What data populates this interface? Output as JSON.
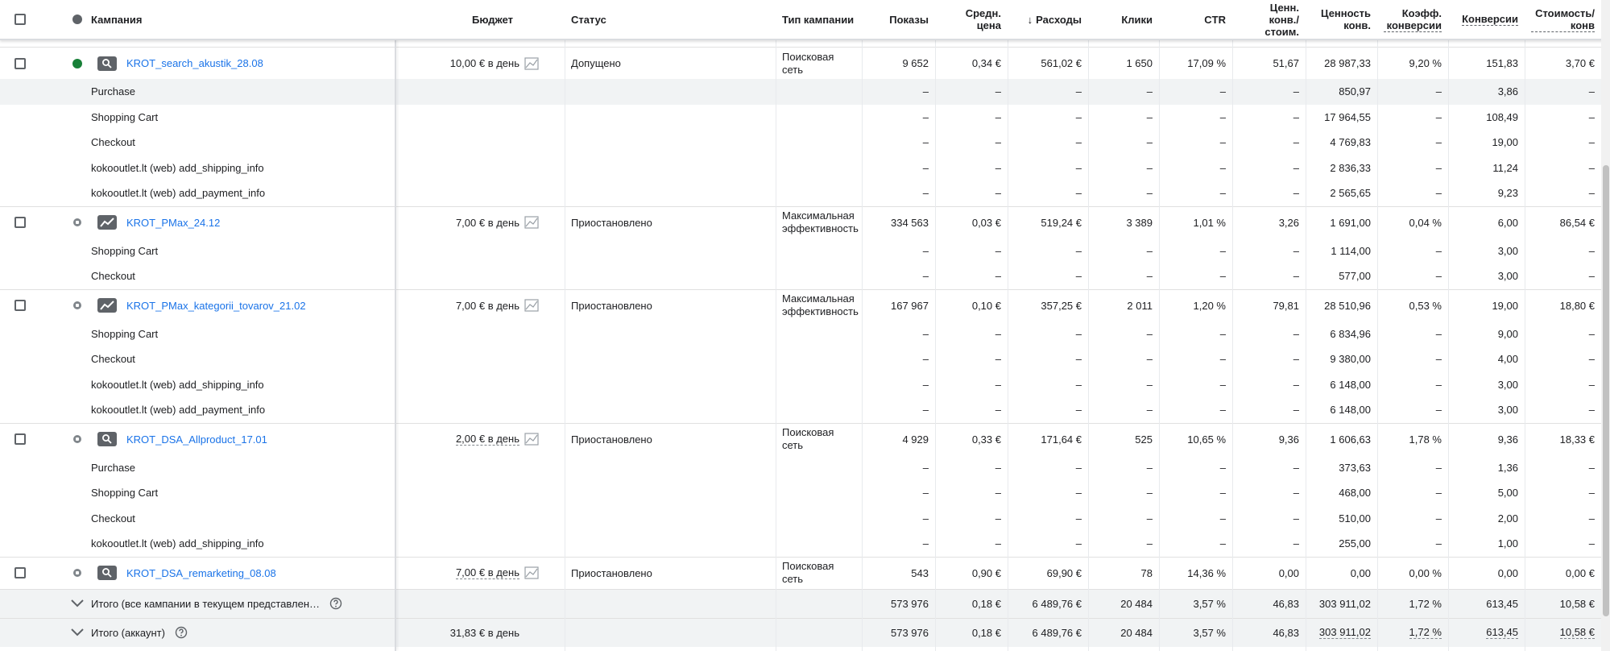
{
  "header": {
    "campaign": "Кампания",
    "budget": "Бюджет",
    "status": "Статус",
    "type": "Тип кампании",
    "impressions": "Показы",
    "avg_cpc": "Средн. цена",
    "sort_arrow": "↓",
    "cost": "Расходы",
    "clicks": "Клики",
    "ctr": "CTR",
    "conv_value_cost": "Ценн. конв./ стоим.",
    "conv_value": "Ценность конв.",
    "conv_rate": "Коэфф. конверсии",
    "conversions": "Конверсии",
    "cost_per_conv": "Стоимость/ конв"
  },
  "campaigns": [
    {
      "name": "KROT_search_akustik_28.08",
      "status_dot": "green",
      "type_icon": "search-icon",
      "budget": "10,00 € в день",
      "budget_dashed": false,
      "status": "Допущено",
      "type": "Поисковая сеть",
      "impressions": "9 652",
      "avg_cpc": "0,34 €",
      "cost": "561,02 €",
      "clicks": "1 650",
      "ctr": "17,09 %",
      "conv_value_cost": "51,67",
      "conv_value": "28 987,33",
      "conv_rate": "9,20 %",
      "conversions": "151,83",
      "cost_per_conv": "3,70 €",
      "sub": [
        {
          "name": "Purchase",
          "conv_value": "850,97",
          "conversions": "3,86"
        },
        {
          "name": "Shopping Cart",
          "conv_value": "17 964,55",
          "conversions": "108,49"
        },
        {
          "name": "Checkout",
          "conv_value": "4 769,83",
          "conversions": "19,00"
        },
        {
          "name": "kokooutlet.lt (web) add_shipping_info",
          "conv_value": "2 836,33",
          "conversions": "11,24"
        },
        {
          "name": "kokooutlet.lt (web) add_payment_info",
          "conv_value": "2 565,65",
          "conversions": "9,23"
        }
      ]
    },
    {
      "name": "KROT_PMax_24.12",
      "status_dot": "grey",
      "type_icon": "performance-max-icon",
      "budget": "7,00 € в день",
      "budget_dashed": false,
      "status": "Приостановлено",
      "type": "Максимальная эффективность",
      "impressions": "334 563",
      "avg_cpc": "0,03 €",
      "cost": "519,24 €",
      "clicks": "3 389",
      "ctr": "1,01 %",
      "conv_value_cost": "3,26",
      "conv_value": "1 691,00",
      "conv_rate": "0,04 %",
      "conversions": "6,00",
      "cost_per_conv": "86,54 €",
      "sub": [
        {
          "name": "Shopping Cart",
          "conv_value": "1 114,00",
          "conversions": "3,00"
        },
        {
          "name": "Checkout",
          "conv_value": "577,00",
          "conversions": "3,00"
        }
      ]
    },
    {
      "name": "KROT_PMax_kategorii_tovarov_21.02",
      "status_dot": "grey",
      "type_icon": "performance-max-icon",
      "budget": "7,00 € в день",
      "budget_dashed": false,
      "status": "Приостановлено",
      "type": "Максимальная эффективность",
      "impressions": "167 967",
      "avg_cpc": "0,10 €",
      "cost": "357,25 €",
      "clicks": "2 011",
      "ctr": "1,20 %",
      "conv_value_cost": "79,81",
      "conv_value": "28 510,96",
      "conv_rate": "0,53 %",
      "conversions": "19,00",
      "cost_per_conv": "18,80 €",
      "sub": [
        {
          "name": "Shopping Cart",
          "conv_value": "6 834,96",
          "conversions": "9,00"
        },
        {
          "name": "Checkout",
          "conv_value": "9 380,00",
          "conversions": "4,00"
        },
        {
          "name": "kokooutlet.lt (web) add_shipping_info",
          "conv_value": "6 148,00",
          "conversions": "3,00"
        },
        {
          "name": "kokooutlet.lt (web) add_payment_info",
          "conv_value": "6 148,00",
          "conversions": "3,00"
        }
      ]
    },
    {
      "name": "KROT_DSA_Allproduct_17.01",
      "status_dot": "grey",
      "type_icon": "search-icon",
      "budget": "2,00 € в день",
      "budget_dashed": true,
      "status": "Приостановлено",
      "type": "Поисковая сеть",
      "impressions": "4 929",
      "avg_cpc": "0,33 €",
      "cost": "171,64 €",
      "clicks": "525",
      "ctr": "10,65 %",
      "conv_value_cost": "9,36",
      "conv_value": "1 606,63",
      "conv_rate": "1,78 %",
      "conversions": "9,36",
      "cost_per_conv": "18,33 €",
      "sub": [
        {
          "name": "Purchase",
          "conv_value": "373,63",
          "conversions": "1,36"
        },
        {
          "name": "Shopping Cart",
          "conv_value": "468,00",
          "conversions": "5,00"
        },
        {
          "name": "Checkout",
          "conv_value": "510,00",
          "conversions": "2,00"
        },
        {
          "name": "kokooutlet.lt (web) add_shipping_info",
          "conv_value": "255,00",
          "conversions": "1,00"
        }
      ]
    },
    {
      "name": "KROT_DSA_remarketing_08.08",
      "status_dot": "grey",
      "type_icon": "search-icon",
      "budget": "7,00 € в день",
      "budget_dashed": true,
      "status": "Приостановлено",
      "type": "Поисковая сеть",
      "impressions": "543",
      "avg_cpc": "0,90 €",
      "cost": "69,90 €",
      "clicks": "78",
      "ctr": "14,36 %",
      "conv_value_cost": "0,00",
      "conv_value": "0,00",
      "conv_rate": "0,00 %",
      "conversions": "0,00",
      "cost_per_conv": "0,00 €",
      "sub": []
    }
  ],
  "dash": "–",
  "totals": [
    {
      "label": "Итого (все кампании в текущем представлен…",
      "budget": "",
      "impressions": "573 976",
      "avg_cpc": "0,18 €",
      "cost": "6 489,76 €",
      "clicks": "20 484",
      "ctr": "3,57 %",
      "conv_value_cost": "46,83",
      "conv_value": "303 911,02",
      "conv_rate": "1,72 %",
      "conversions": "613,45",
      "cost_per_conv": "10,58 €"
    },
    {
      "label": "Итого (аккаунт)",
      "budget": "31,83 € в день",
      "impressions": "573 976",
      "avg_cpc": "0,18 €",
      "cost": "6 489,76 €",
      "clicks": "20 484",
      "ctr": "3,57 %",
      "conv_value_cost": "46,83",
      "conv_value": "303 911,02",
      "conv_rate": "1,72 %",
      "conversions": "613,45",
      "cost_per_conv": "10,58 €"
    }
  ],
  "colors": {
    "link": "#1a73e8",
    "enabled_dot": "#188038",
    "paused_dot": "#80868b",
    "row_highlight": "#f1f3f4"
  }
}
